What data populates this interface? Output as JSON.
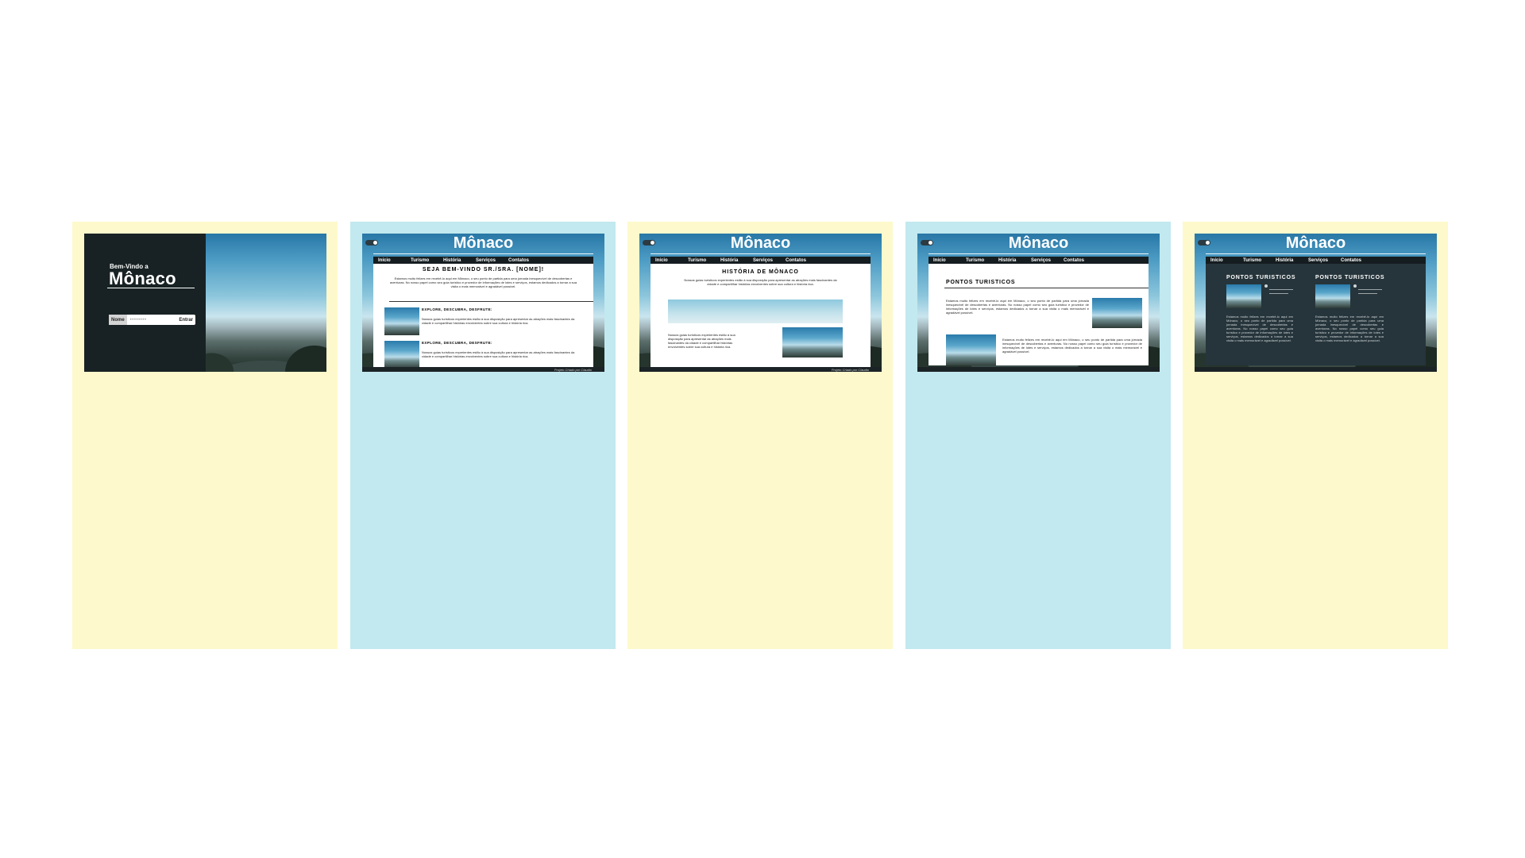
{
  "login": {
    "welcome_small": "Bem-Vindo a",
    "welcome_big": "Mônaco",
    "label": "Nome",
    "input_value": "••••••••",
    "button": "Entrar"
  },
  "site": {
    "title": "Mônaco",
    "nav": [
      "Início",
      "Turismo",
      "História",
      "Serviços",
      "Contatos"
    ],
    "footer": "Projeto Criado por Claudio"
  },
  "home": {
    "heading": "SEJA BEM-VINDO SR./SRA. [NOME]!",
    "intro": "Estamos muito felizes em recebê-lo aqui em Mônaco, o seu ponto de partida para uma jornada inesquecível de descobertas e aventuras. No nosso papel como seu guia turístico e provedor de informações de lotes e serviços, estamos dedicados a tornar a sua visita o mais memorável e agradável possível.",
    "section1_title": "EXPLORE, DESCUBRA, DESFRUTE:",
    "section1_text": "Nossos guias turísticos experientes estão à sua disposição para apresentar as atrações mais fascinantes da cidade e compartilhar histórias envolventes sobre sua cultura e história rica.",
    "section2_title": "EXPLORE, DESCUBRA, DESFRUTE:",
    "section2_text": "Nossos guias turísticos experientes estão à sua disposição para apresentar as atrações mais fascinantes da cidade e compartilhar histórias envolventes sobre sua cultura e história rica."
  },
  "history": {
    "heading": "HISTÓRIA DE MÔNACO",
    "intro": "Nossos guias turísticos experientes estão à sua disposição para apresentar as atrações mais fascinantes da cidade e compartilhar histórias envolventes sobre sua cultura e história rica.",
    "body": "Nossos guias turísticos experientes estão à sua disposição para apresentar as atrações mais fascinantes da cidade e compartilhar histórias envolventes sobre sua cultura e história rica."
  },
  "tourism": {
    "heading": "PONTOS TURISTICOS",
    "text1": "Estamos muito felizes em recebê-lo aqui em Mônaco, o seu ponto de partida para uma jornada inesquecível de descobertas e aventuras. No nosso papel como seu guia turístico e provedor de informações de lotes e serviços, estamos dedicados a tornar a sua visita o mais memorável e agradável possível.",
    "text2": "Estamos muito felizes em recebê-lo aqui em Mônaco, o seu ponto de partida para uma jornada inesquecível de descobertas e aventuras. No nosso papel como seu guia turístico e provedor de informações de lotes e serviços, estamos dedicados a tornar a sua visita o mais memorável e agradável possível."
  },
  "dark": {
    "col1_heading": "PONTOS TURISTICOS",
    "col2_heading": "PONTOS TURISTICOS",
    "col1_text": "Estamos muito felizes em recebê-lo aqui em Mônaco, o seu ponto de partida para uma jornada inesquecível de descobertas e aventuras. No nosso papel como seu guia turístico e provedor de informações de lotes e serviços, estamos dedicados a tornar a sua visita o mais memorável e agradável possível.",
    "col2_text": "Estamos muito felizes em recebê-lo aqui em Mônaco, o seu ponto de partida para uma jornada inesquecível de descobertas e aventuras. No nosso papel como seu guia turístico e provedor de informações de lotes e serviços, estamos dedicados a tornar a sua visita o mais memorável e agradável possível."
  },
  "colors": {
    "board_yellow": "#fdf9cc",
    "board_blue": "#c2e9ef",
    "dark_panel": "#26353b",
    "nav_bg": "#151d20"
  }
}
